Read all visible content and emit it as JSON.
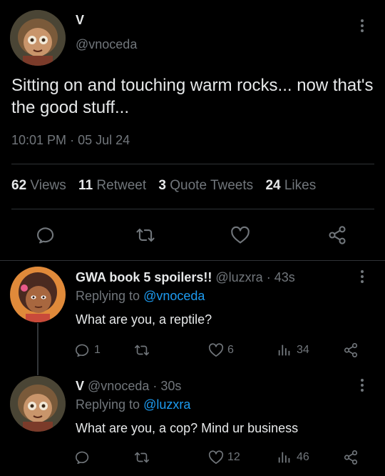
{
  "main_tweet": {
    "author_name": "V",
    "author_handle": "@vnoceda",
    "text": "Sitting on and touching warm rocks... now that's the good stuff...",
    "time": "10:01 PM",
    "separator": "·",
    "date": "05 Jul 24",
    "stats": {
      "views_count": "62",
      "views_label": "Views",
      "retweets_count": "11",
      "retweets_label": "Retweet",
      "quotes_count": "3",
      "quotes_label": "Quote Tweets",
      "likes_count": "24",
      "likes_label": "Likes"
    },
    "actions": [
      "reply-icon",
      "retweet-icon",
      "like-icon",
      "share-icon"
    ]
  },
  "replies": [
    {
      "author_name": "GWA book 5 spoilers!!",
      "author_handle": "@luzxra",
      "dot": "·",
      "age": "43s",
      "replying_label": "Replying to",
      "replying_to": "@vnoceda",
      "text": "What are you, a reptile?",
      "reply_count": "1",
      "retweet_count": "",
      "like_count": "6",
      "view_count": "34"
    },
    {
      "author_name": "V",
      "author_handle": "@vnoceda",
      "dot": "·",
      "age": "30s",
      "replying_label": "Replying to",
      "replying_to": "@luzxra",
      "text": "What are you, a cop? Mind ur business",
      "reply_count": "",
      "retweet_count": "",
      "like_count": "12",
      "view_count": "46"
    }
  ],
  "colors": {
    "background": "#000000",
    "text": "#e7e9ea",
    "muted": "#71767b",
    "accent": "#1d9bf0",
    "divider": "#2f3336"
  }
}
